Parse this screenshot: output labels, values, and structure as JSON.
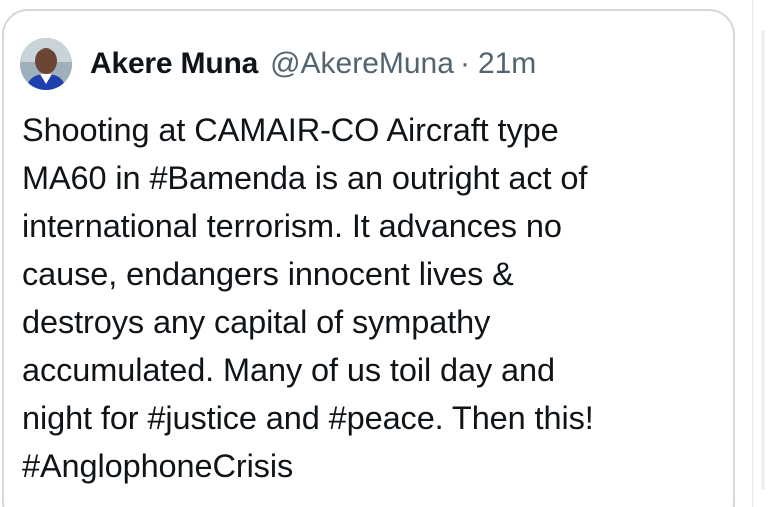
{
  "tweet": {
    "author": {
      "display_name": "Akere Muna",
      "handle": "@AkereMuna",
      "separator": "·",
      "time": "21m",
      "avatar_icon": "user-avatar-photo"
    },
    "text_lines": [
      "Shooting at CAMAIR-CO Aircraft type",
      "MA60 in #Bamenda is an outright act of",
      "international terrorism. It advances no",
      "cause, endangers innocent lives &",
      "destroys any capital of sympathy",
      "accumulated. Many of us toil day and",
      "night for #justice and #peace. Then this!",
      "#AnglophoneCrisis"
    ]
  },
  "colors": {
    "text_primary": "#0f1419",
    "text_secondary": "#536471",
    "card_border": "#d3d8dc",
    "background": "#ffffff"
  }
}
